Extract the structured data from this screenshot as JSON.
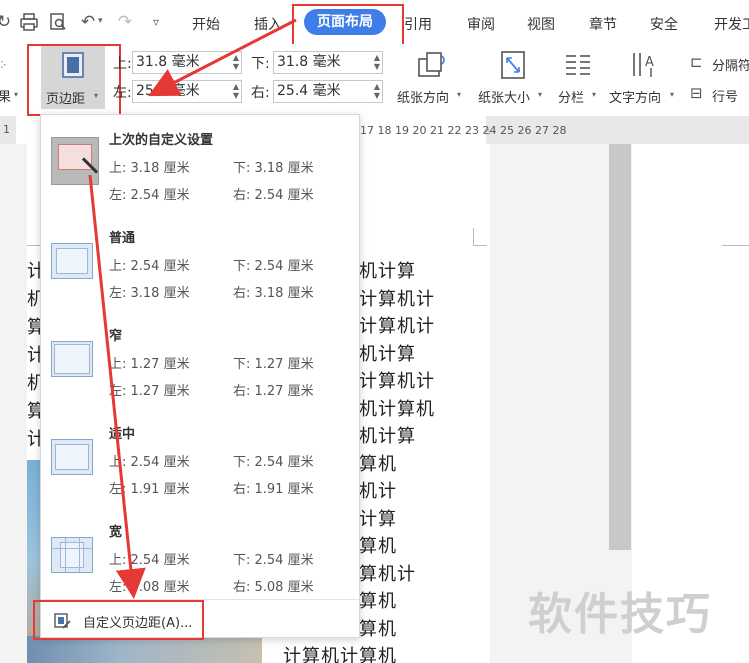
{
  "menubar": {
    "tabs": [
      "开始",
      "插入",
      "页面布局",
      "引用",
      "审阅",
      "视图",
      "章节",
      "安全",
      "开发工"
    ],
    "active_tab": "页面布局"
  },
  "ribbon": {
    "partial_left_label": "果",
    "margin_button_label": "页边距",
    "top_label": "上:",
    "top_value": "31.8 毫米",
    "bottom_label": "下:",
    "bottom_value": "31.8 毫米",
    "left_label": "左:",
    "left_value": "25.4 毫米",
    "right_label": "右:",
    "right_value": "25.4 毫米",
    "orientation_label": "纸张方向",
    "size_label": "纸张大小",
    "columns_label": "分栏",
    "text_dir_label": "文字方向",
    "separator_label": "分隔符",
    "line_num_label": "行号"
  },
  "ruler": {
    "ticks": [
      "17",
      "18",
      "19",
      "20",
      "21",
      "22",
      "23",
      "24",
      "25",
      "26",
      "27",
      "28"
    ],
    "left_tick": "1"
  },
  "dropdown": {
    "options": [
      {
        "title": "上次的自定义设置",
        "top": "上: 3.18 厘米",
        "bottom": "下: 3.18 厘米",
        "left": "左: 2.54 厘米",
        "right": "右: 2.54 厘米"
      },
      {
        "title": "普通",
        "top": "上: 2.54 厘米",
        "bottom": "下: 2.54 厘米",
        "left": "左: 3.18 厘米",
        "right": "右: 3.18 厘米"
      },
      {
        "title": "窄",
        "top": "上: 1.27 厘米",
        "bottom": "下: 1.27 厘米",
        "left": "左: 1.27 厘米",
        "right": "右: 1.27 厘米"
      },
      {
        "title": "适中",
        "top": "上: 2.54 厘米",
        "bottom": "下: 2.54 厘米",
        "left": "左: 1.91 厘米",
        "right": "右: 1.91 厘米"
      },
      {
        "title": "宽",
        "top": "上: 2.54 厘米",
        "bottom": "下: 2.54 厘米",
        "left": "左: 5.08 厘米",
        "right": "右: 5.08 厘米"
      }
    ],
    "custom_label": "自定义页边距(A)..."
  },
  "document": {
    "left_chars": [
      "计",
      "机",
      "算",
      "计",
      "机",
      "算",
      "计"
    ],
    "lines": [
      "算机计算机计算",
      "机计算机计算机计",
      "机计算机计算机计",
      "算机计算机计算",
      "机计算机计算机计",
      "算机计算机计算机",
      "算机计算机计算",
      "计算机计算机",
      "算机计算机计",
      "机计算机计算",
      "计算机计算机",
      "计算机计算机计",
      "计算机计算机",
      "计算机计算机",
      "计算机计算机",
      "计算机计算机计"
    ]
  },
  "watermark": "软件技巧",
  "colors": {
    "accent": "#3f7ee8",
    "highlight": "#e53935"
  }
}
